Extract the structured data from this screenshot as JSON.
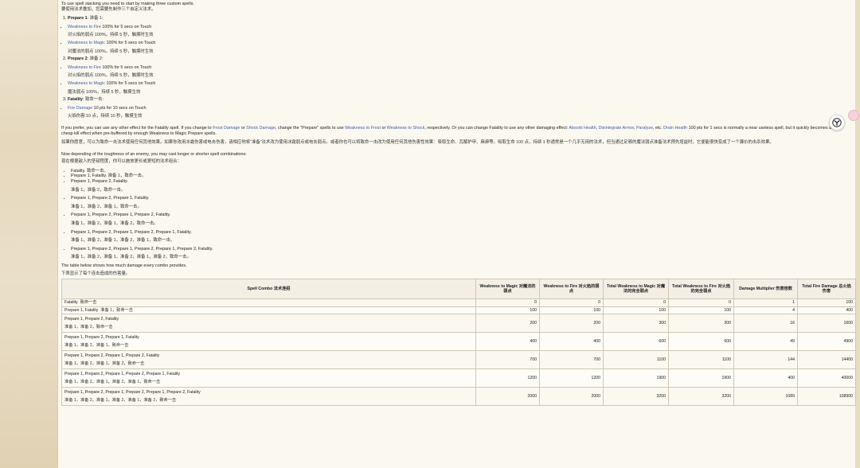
{
  "intro_top": "To use spell stacking you need to start by making three custom spells.",
  "intro_top_zh": "要使用法术叠加，您需要先制作三个自定义法术。",
  "custom_spells": [
    {
      "title": "Prepare 1",
      "title_zh": "准备 1",
      "effects": [
        {
          "name": "Weakness to Fire",
          "rest": " 100% for 5 secs on Touch",
          "zh": "对火焰的弱点 100%，持续 5 秒，触摸时生效"
        },
        {
          "name": "Weakness to Magic",
          "rest": " 100% for 5 secs on Touch",
          "zh": "对魔法的弱点 100%，持续 5 秒，触摸时生效"
        }
      ]
    },
    {
      "title": "Prepare 2",
      "title_zh": "准备 2",
      "effects": [
        {
          "name": "Weakness to Fire",
          "rest": " 100% for 5 secs on Touch",
          "zh": "对火焰的弱点 100%，持续 5 秒，触摸时生效"
        },
        {
          "name": "Weakness to Magic",
          "rest": " 100% for 5 secs on Touch",
          "zh": "魔法弱点 100%，持续 5 秒，触摸生效"
        }
      ]
    },
    {
      "title": "Fatality",
      "title_zh": "致命一击",
      "effects": [
        {
          "name": "Fire Damage",
          "rest": " 10 pts for 10 secs on Touch",
          "zh": "火焰伤害 10 点，持续 10 秒，触摸生效"
        }
      ]
    }
  ],
  "alt_text": {
    "p1": "If you prefer, you can use any other effect for the Fatality spell. If you change to ",
    "l1": "Frost Damage",
    "p2": " or ",
    "l2": "Shock Damage",
    "p3": ", change the \"Prepare\" spells to use ",
    "l3": "Weakness to Frost",
    "p4": " or ",
    "l4": "Weakness to Shock",
    "p5": ", respectively. Or you can change Fatality to use any other damaging effect: ",
    "l5": "Absorb Health",
    "p6": ", ",
    "l6": "Disintegrate Armor",
    "p7": ", ",
    "l7": "Paralyze",
    "p8": ", etc. ",
    "l8": "Drain Health",
    "p9": " 100 pts for 1 secs is normally a near useless spell, but it quickly becomes a",
    "line2": "cheap kill effect when pre-buffered by enough Weakness to Magic Prepare spells.",
    "zh": "如果你愿意，可以为致命一击法术使用任何其他效果。如果你改用冰霜伤害或电击伤害，请相应地将“准备”法术改为使用冰霜弱点或电击弱点。或者你也可以将致命一击改为使用任何其他伤害性效果：吸取生命、瓦解护甲、麻痹等。吸取生命 100 点，持续 1 秒通常是一个几乎无用的法术，但当通过足够的魔法弱点准备法术预先增益时，它便能很快变成了一个廉价的击杀效果。"
  },
  "toughness_text": "Now depending of the toughness of an enemy, you may cast longer or shorter spell combinations:",
  "toughness_text_zh": "现在根据敌人的坚韧程度，你可以施放更长或更短的法术组合：",
  "combos": [
    {
      "en": "Fatality.",
      "zh": "致命一击。"
    },
    {
      "en": "Prepare 1, Fatality.",
      "zh": "准备 1，致命一击。"
    },
    {
      "en": "Prepare 1, Prepare 2, Fatality.",
      "zh": "准备 1，准备 2，致命一击。"
    },
    {
      "en": "Prepare 1, Prepare 2, Prepare 1, Fatality.",
      "zh": "准备 1，准备 2，准备 1，致命一击。"
    },
    {
      "en": "Prepare 1, Prepare 2, Prepare 1, Prepare 2, Fatality.",
      "zh": "准备 1，准备 2，准备 1，准备 2，致命一击。"
    },
    {
      "en": "Prepare 1, Prepare 2, Prepare 1, Prepare 2, Prepare 1, Fatality.",
      "zh": "准备 1，准备 2，准备 1，准备 2，准备 1，致命一击。"
    },
    {
      "en": "Prepare 1, Prepare 2, Prepare 1, Prepare 2, Prepare 1, Prepare 2, Fatality.",
      "zh": "准备 1，准备 2，准备 1，准备 2，准备 1，准备 2，致命一击。"
    }
  ],
  "table_intro": "The table below shows how much damage every combo provides.",
  "table_intro_zh": "下表显示了每个连击造成的伤害量。",
  "table": {
    "headers": [
      "Spell Combo  法术连招",
      "Weakness to Magic  对魔法的弱点",
      "Weakness to Fire  对火焰的弱点",
      "Total Weakness to Magic  对魔法的完全弱点",
      "Total Weakness to Fire  对火焰的完全弱点",
      "Damage Multiplier  伤害倍数",
      "Total Fire Damage  总火焰伤害"
    ],
    "rows": [
      {
        "en": "Fatality",
        "zh": "致命一击",
        "v": [
          "0",
          "0",
          "0",
          "0",
          "1",
          "100"
        ]
      },
      {
        "en": "Prepare 1, Fatality",
        "zh": "准备 1，致命一击",
        "v": [
          "100",
          "100",
          "100",
          "100",
          "4",
          "400"
        ]
      },
      {
        "en": "Prepare 1, Prepare 2, Fatality",
        "zh": "准备 1，准备 2，致命一击",
        "v": [
          "200",
          "200",
          "300",
          "300",
          "16",
          "1600"
        ]
      },
      {
        "en": "Prepare 1, Prepare 2, Prepare 1, Fatality",
        "zh": "准备 1，准备 2，准备 1，致命一击",
        "v": [
          "400",
          "400",
          "600",
          "600",
          "49",
          "4900"
        ]
      },
      {
        "en": "Prepare 1, Prepare 2, Prepare 1, Prepare 2, Fatality",
        "zh": "准备 1，准备 2，准备 1，准备 2，致命一击",
        "v": [
          "700",
          "700",
          "1100",
          "1100",
          "144",
          "14400"
        ]
      },
      {
        "en": "Prepare 1, Prepare 2, Prepare 1, Prepare 2, Prepare 1, Fatality",
        "zh": "准备 1，准备 2，准备 1，准备 2，准备 1，致命一击",
        "v": [
          "1200",
          "1200",
          "1900",
          "1900",
          "400",
          "40000"
        ]
      },
      {
        "en": "Prepare 1, Prepare 2, Prepare 1, Prepare 2, Prepare 1, Prepare 2, Fatality",
        "zh": "准备 1，准备 2，准备 1，准备 2，准备 1，准备 2，致命一击",
        "v": [
          "2000",
          "2000",
          "3200",
          "3200",
          "1089",
          "108900"
        ]
      }
    ]
  },
  "floating_icon": "translate-assistant-icon",
  "colors": {
    "link": "#3c5fa6",
    "page": "#fbf8ef",
    "parchment": "#e7dcc4"
  }
}
